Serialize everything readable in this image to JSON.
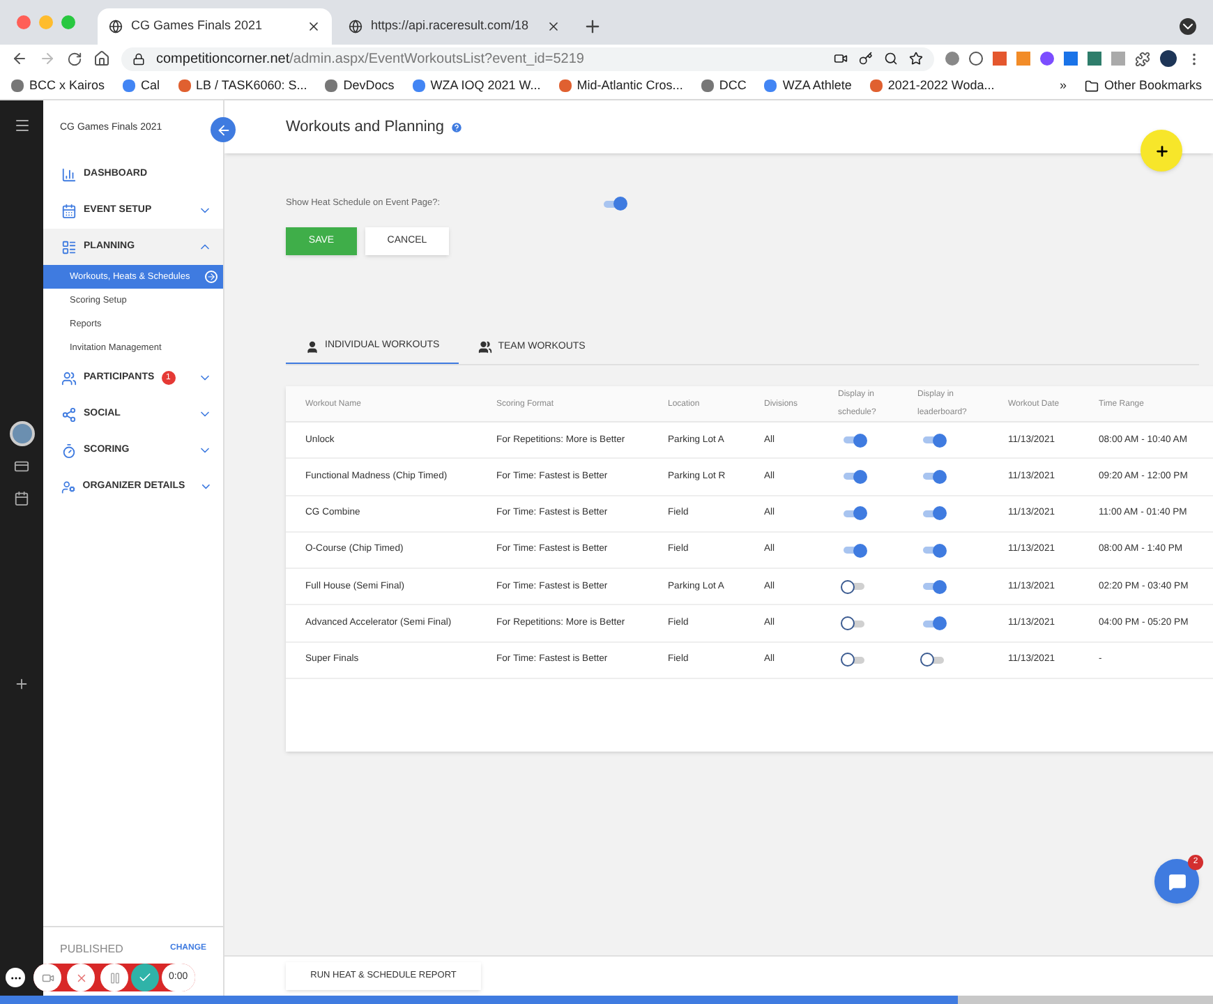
{
  "browser": {
    "tabs": [
      {
        "title": "CG Games Finals 2021",
        "selected": true
      },
      {
        "title": "https://api.raceresult.com/18",
        "selected": false
      }
    ],
    "url_host": "competitioncorner.net",
    "url_path": "/admin.aspx/EventWorkoutsList?event_id=5219",
    "bookmarks": [
      "BCC x Kairos",
      "Cal",
      "LB / TASK6060: S...",
      "DevDocs",
      "WZA IOQ 2021 W...",
      "Mid-Atlantic Cros...",
      "DCC",
      "WZA Athlete",
      "2021-2022 Woda..."
    ],
    "overflow": "»",
    "other_bookmarks": "Other Bookmarks"
  },
  "sidebar": {
    "event_title": "CG Games Finals 2021",
    "nav": [
      {
        "label": "DASHBOARD"
      },
      {
        "label": "EVENT SETUP",
        "expanded": false
      },
      {
        "label": "PLANNING",
        "expanded": true,
        "children": [
          {
            "label": "Workouts, Heats & Schedules",
            "selected": true
          },
          {
            "label": "Scoring Setup",
            "selected": false
          },
          {
            "label": "Reports",
            "selected": false
          },
          {
            "label": "Invitation Management",
            "selected": false
          }
        ]
      },
      {
        "label": "PARTICIPANTS",
        "expanded": false,
        "badge": "1"
      },
      {
        "label": "SOCIAL",
        "expanded": false
      },
      {
        "label": "SCORING",
        "expanded": false
      },
      {
        "label": "ORGANIZER DETAILS",
        "expanded": false
      }
    ],
    "status": "PUBLISHED",
    "status_action": "CHANGE"
  },
  "page": {
    "title": "Workouts and Planning",
    "heat_schedule": {
      "label": "Show Heat Schedule on Event Page?:",
      "on": true
    },
    "save": "SAVE",
    "cancel": "CANCEL",
    "tabs": [
      {
        "label": "INDIVIDUAL WORKOUTS",
        "selected": true
      },
      {
        "label": "TEAM WORKOUTS",
        "selected": false
      }
    ],
    "table": {
      "columns": [
        "Workout Name",
        "Scoring Format",
        "Location",
        "Divisions",
        "Display in schedule?",
        "Display in leaderboard?",
        "Workout Date",
        "Time Range"
      ],
      "rows": [
        {
          "name": "Unlock",
          "scoring": "For Repetitions: More is Better",
          "location": "Parking Lot A",
          "divisions": "All",
          "in_schedule": true,
          "in_leaderboard": true,
          "date": "11/13/2021",
          "time_range": "08:00 AM - 10:40 AM"
        },
        {
          "name": "Functional Madness (Chip Timed)",
          "scoring": "For Time: Fastest is Better",
          "location": "Parking Lot R",
          "divisions": "All",
          "in_schedule": true,
          "in_leaderboard": true,
          "date": "11/13/2021",
          "time_range": "09:20 AM - 12:00 PM"
        },
        {
          "name": "CG Combine",
          "scoring": "For Time: Fastest is Better",
          "location": "Field",
          "divisions": "All",
          "in_schedule": true,
          "in_leaderboard": true,
          "date": "11/13/2021",
          "time_range": "11:00 AM - 01:40 PM"
        },
        {
          "name": "O-Course (Chip Timed)",
          "scoring": "For Time: Fastest is Better",
          "location": "Field",
          "divisions": "All",
          "in_schedule": true,
          "in_leaderboard": true,
          "date": "11/13/2021",
          "time_range": "08:00 AM - 1:40 PM"
        },
        {
          "name": "Full House (Semi Final)",
          "scoring": "For Time: Fastest is Better",
          "location": "Parking Lot A",
          "divisions": "All",
          "in_schedule": false,
          "in_leaderboard": true,
          "date": "11/13/2021",
          "time_range": "02:20 PM - 03:40 PM"
        },
        {
          "name": "Advanced Accelerator (Semi Final)",
          "scoring": "For Repetitions: More is Better",
          "location": "Field",
          "divisions": "All",
          "in_schedule": false,
          "in_leaderboard": true,
          "date": "11/13/2021",
          "time_range": "04:00 PM - 05:20 PM"
        },
        {
          "name": "Super Finals",
          "scoring": "For Time: Fastest is Better",
          "location": "Field",
          "divisions": "All",
          "in_schedule": false,
          "in_leaderboard": false,
          "date": "11/13/2021",
          "time_range": "-"
        }
      ]
    },
    "report_button": "RUN HEAT & SCHEDULE REPORT",
    "chat_badge": "2"
  },
  "recorder": {
    "timer": "0:00",
    "progress": {
      "level": 0.79
    }
  }
}
